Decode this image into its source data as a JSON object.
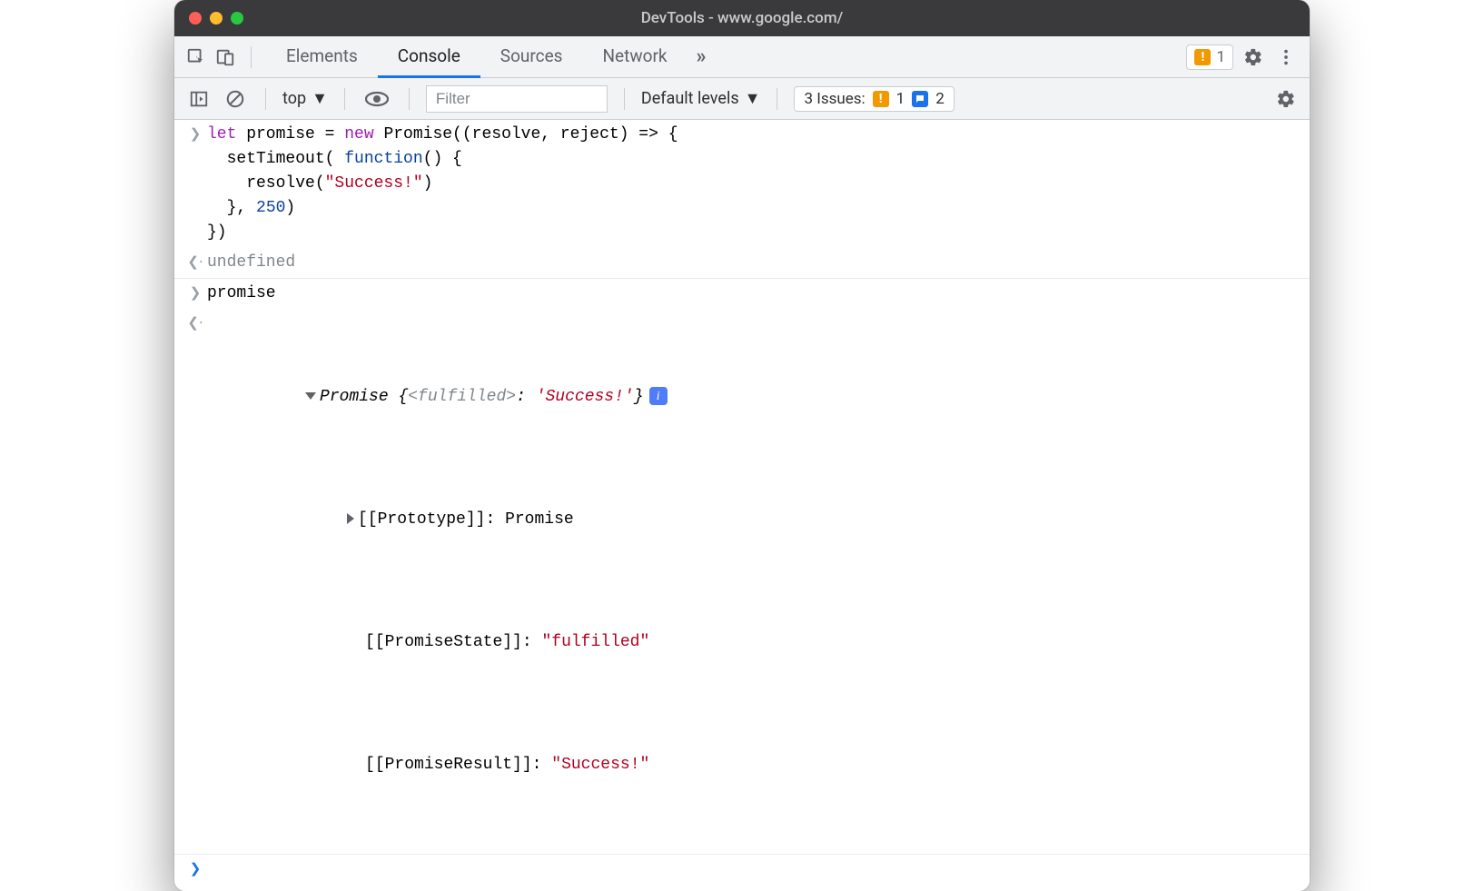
{
  "window": {
    "title": "DevTools - www.google.com/"
  },
  "tabs": {
    "elements": "Elements",
    "console": "Console",
    "sources": "Sources",
    "network": "Network"
  },
  "toolbar": {
    "top_issue_count": "1"
  },
  "subtoolbar": {
    "context": "top",
    "filter_placeholder": "Filter",
    "levels": "Default levels",
    "issues_label": "3 Issues:",
    "issues_warn": "1",
    "issues_info": "2"
  },
  "console": {
    "input1": {
      "l1_a": "let",
      "l1_b": " promise = ",
      "l1_c": "new",
      "l1_d": " Promise((resolve, reject) => {",
      "l2_a": "  setTimeout( ",
      "l2_b": "function",
      "l2_c": "() {",
      "l3_a": "    resolve(",
      "l3_b": "\"Success!\"",
      "l3_c": ")",
      "l4_a": "  }, ",
      "l4_b": "250",
      "l4_c": ")",
      "l5": "})"
    },
    "output1": "undefined",
    "input2": "promise",
    "output2": {
      "head_a": "Promise {",
      "head_b": "<fulfilled>",
      "head_c": ": ",
      "head_d": "'Success!'",
      "head_e": "}",
      "proto_k": "[[Prototype]]",
      "proto_v": "Promise",
      "state_k": "[[PromiseState]]",
      "state_v": "\"fulfilled\"",
      "result_k": "[[PromiseResult]]",
      "result_v": "\"Success!\""
    }
  }
}
